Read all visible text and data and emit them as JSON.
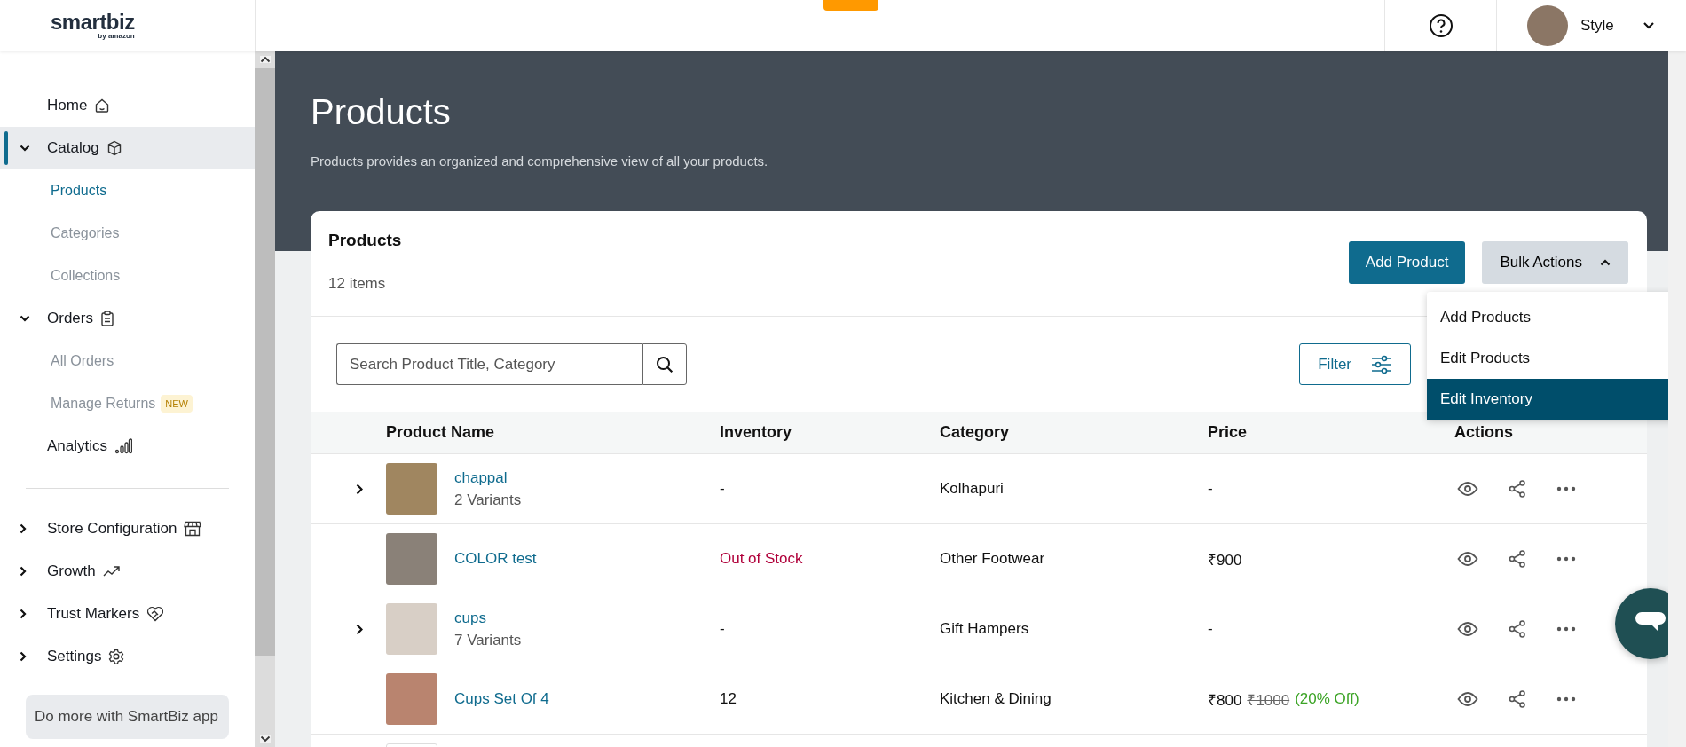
{
  "header": {
    "logo": "smartbiz",
    "logo_sub": "by amazon",
    "user": {
      "name": "Style"
    }
  },
  "nav_primary": [
    {
      "label": "Home",
      "selected": false
    },
    {
      "label": "Catalog",
      "selected": true,
      "expanded": true,
      "children": [
        {
          "label": "Products",
          "selected": true
        },
        {
          "label": "Categories",
          "selected": false
        },
        {
          "label": "Collections",
          "selected": false
        }
      ]
    },
    {
      "label": "Orders",
      "selected": false,
      "expanded": true,
      "children": [
        {
          "label": "All Orders",
          "selected": false
        },
        {
          "label": "Manage Returns",
          "badge": "NEW",
          "selected": false
        }
      ]
    },
    {
      "label": "Analytics",
      "selected": false
    }
  ],
  "nav_secondary": [
    {
      "label": "Store Configuration",
      "expanded": false
    },
    {
      "label": "Growth",
      "expanded": false
    },
    {
      "label": "Trust Markers",
      "expanded": false
    },
    {
      "label": "Settings",
      "expanded": false
    }
  ],
  "promo": "Do more with SmartBiz app",
  "page": {
    "title": "Products",
    "description": "Products provides an organized and comprehensive view of all your products."
  },
  "card": {
    "title": "Products",
    "count": "12 items",
    "add_button": "Add Product",
    "bulk_button": {
      "label": "Bulk Actions",
      "expanded": true
    },
    "bulk_menu": [
      {
        "label": "Add Products",
        "selected": false
      },
      {
        "label": "Edit Products",
        "selected": false
      },
      {
        "label": "Edit Inventory",
        "selected": true
      }
    ],
    "search": {
      "placeholder": "Search Product Title, Category"
    },
    "filter_button": "Filter"
  },
  "table": {
    "columns": [
      "Product Name",
      "Inventory",
      "Category",
      "Price",
      "Actions"
    ],
    "rows": [
      {
        "expandable": true,
        "name": "chappal",
        "variants": "2 Variants",
        "inventory": "-",
        "out_of_stock": false,
        "category": "Kolhapuri",
        "price": "-"
      },
      {
        "expandable": false,
        "name": "COLOR test",
        "inventory": "Out of Stock",
        "out_of_stock": true,
        "category": "Other Footwear",
        "price": "₹900"
      },
      {
        "expandable": true,
        "name": "cups",
        "variants": "7 Variants",
        "inventory": "-",
        "out_of_stock": false,
        "category": "Gift Hampers",
        "price": "-"
      },
      {
        "expandable": false,
        "name": "Cups Set Of 4",
        "inventory": "12",
        "out_of_stock": false,
        "category": "Kitchen & Dining",
        "price": "₹800",
        "original_price": "₹1000",
        "discount": "(20% Off)"
      }
    ]
  }
}
